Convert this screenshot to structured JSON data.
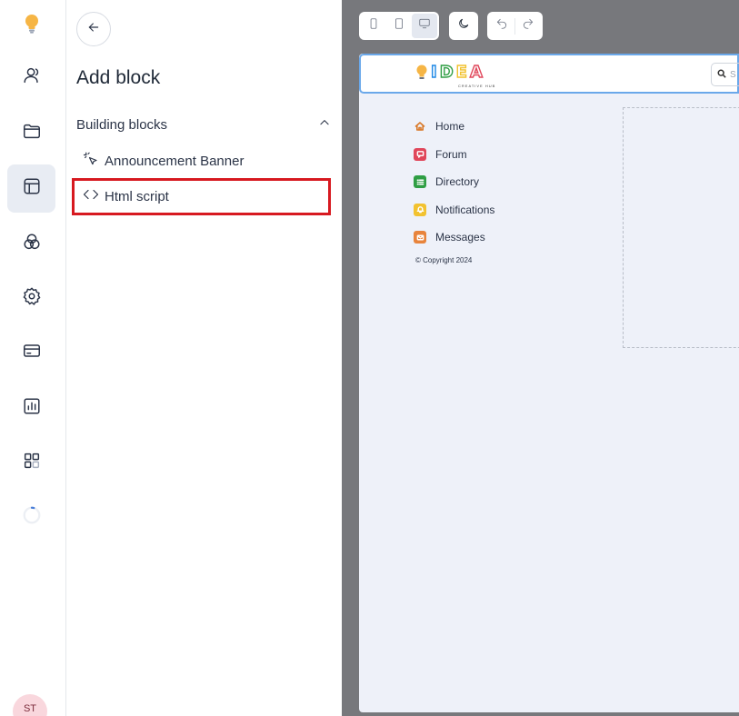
{
  "rail": {
    "avatar_initials": "ST",
    "items": [
      {
        "icon": "lightbulb-logo-icon"
      },
      {
        "icon": "user-icon"
      },
      {
        "icon": "folder-icon"
      },
      {
        "icon": "layout-icon",
        "active": true
      },
      {
        "icon": "circles-icon"
      },
      {
        "icon": "gear-icon"
      },
      {
        "icon": "credit-card-icon"
      },
      {
        "icon": "chart-icon"
      },
      {
        "icon": "apps-grid-icon"
      },
      {
        "icon": "loading-spinner-icon"
      }
    ]
  },
  "panel": {
    "title": "Add block",
    "section": {
      "label": "Building blocks",
      "expanded": true,
      "items": [
        {
          "label": "Announcement Banner",
          "icon": "sparkle-cursor-icon"
        },
        {
          "label": "Html script",
          "icon": "code-brackets-icon",
          "highlighted": true
        }
      ]
    }
  },
  "preview": {
    "toolbar": {
      "devices": [
        {
          "icon": "mobile-icon"
        },
        {
          "icon": "tablet-icon"
        },
        {
          "icon": "desktop-icon",
          "active": true
        }
      ],
      "theme_icon": "moon-icon",
      "history": [
        {
          "icon": "undo-icon"
        },
        {
          "icon": "redo-icon"
        }
      ]
    },
    "site": {
      "logo_text": "IDEA",
      "logo_subtitle": "CREATIVE HUB",
      "search_placeholder": "S",
      "nav": [
        {
          "label": "Home",
          "icon": "home-icon",
          "color": "#d97a2b"
        },
        {
          "label": "Forum",
          "icon": "chat-icon",
          "color": "#e0465a"
        },
        {
          "label": "Directory",
          "icon": "list-icon",
          "color": "#2f9e44"
        },
        {
          "label": "Notifications",
          "icon": "bell-icon",
          "color": "#f2c230"
        },
        {
          "label": "Messages",
          "icon": "mail-icon",
          "color": "#e8843c"
        }
      ],
      "copyright": "© Copyright 2024"
    },
    "colors": {
      "accent_highlight": "#d71920",
      "canvas_bg": "#eef1f9",
      "preview_bg": "#77787c"
    }
  }
}
